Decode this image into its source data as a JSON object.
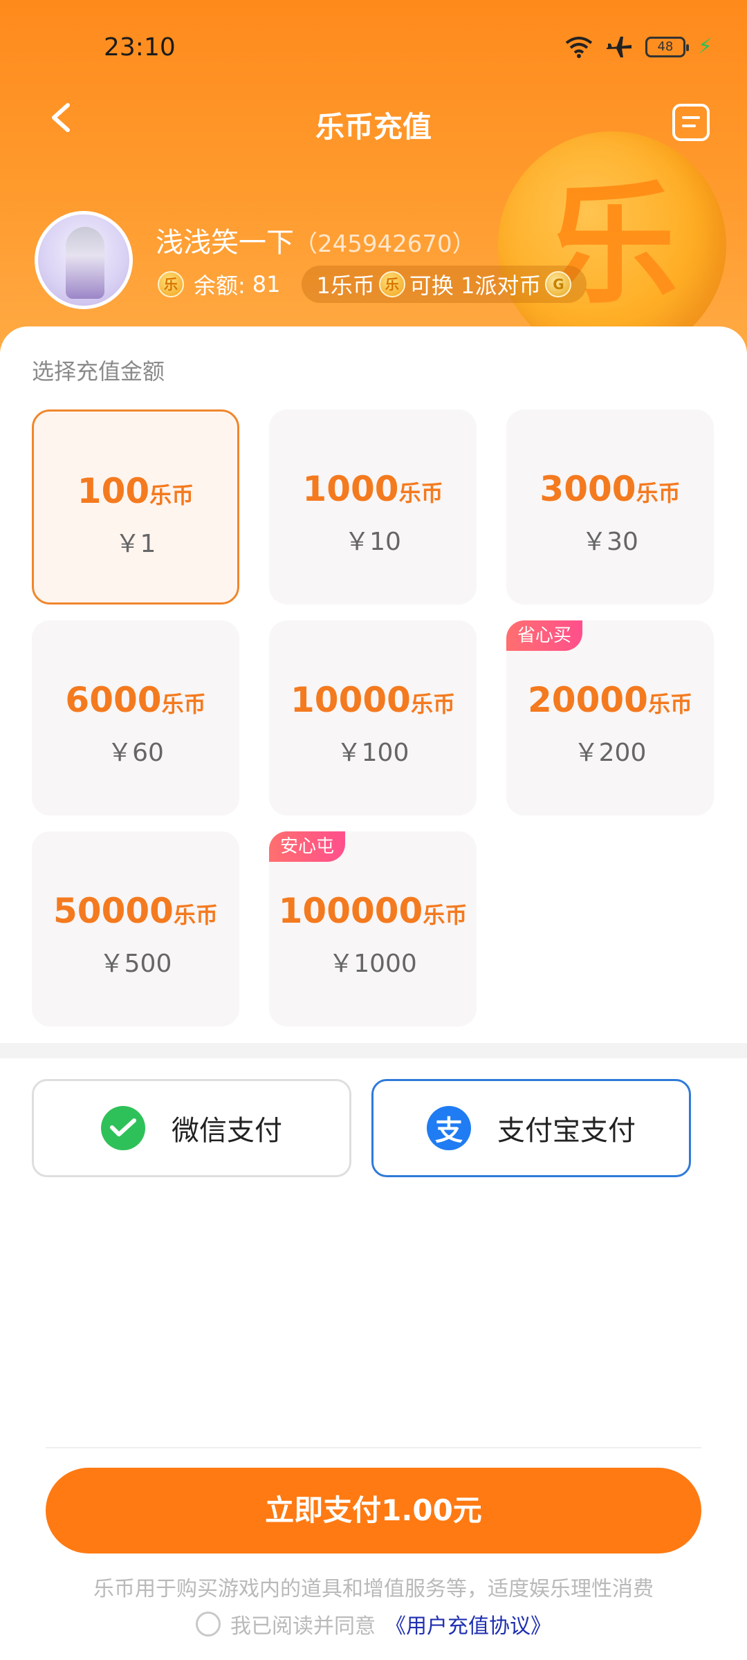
{
  "status_bar": {
    "time": "23:10",
    "battery": "48"
  },
  "nav": {
    "title": "乐币充值"
  },
  "decor": {
    "coin_char": "乐"
  },
  "user": {
    "name": "浅浅笑一下",
    "id": "（245942670）",
    "coin_icon_char": "乐",
    "balance_label": "余额:",
    "balance_value": "81",
    "exchange_prefix": "1乐币",
    "exchange_middle": "可换 1派对币",
    "pai_icon_char": "G"
  },
  "section_label": "选择充值金额",
  "packages": [
    {
      "amount": "100",
      "unit": "乐币",
      "price": "￥1",
      "selected": true
    },
    {
      "amount": "1000",
      "unit": "乐币",
      "price": "￥10"
    },
    {
      "amount": "3000",
      "unit": "乐币",
      "price": "￥30"
    },
    {
      "amount": "6000",
      "unit": "乐币",
      "price": "￥60"
    },
    {
      "amount": "10000",
      "unit": "乐币",
      "price": "￥100"
    },
    {
      "amount": "20000",
      "unit": "乐币",
      "price": "￥200",
      "tag": "省心买"
    },
    {
      "amount": "50000",
      "unit": "乐币",
      "price": "￥500"
    },
    {
      "amount": "100000",
      "unit": "乐币",
      "price": "￥1000",
      "tag": "安心屯"
    }
  ],
  "payment": {
    "wechat_label": "微信支付",
    "alipay_label": "支付宝支付",
    "alipay_icon_char": "支",
    "selected": "alipay"
  },
  "pay_now_label": "立即支付1.00元",
  "notice": "乐币用于购买游戏内的道具和增值服务等，适度娱乐理性消费",
  "agreement": {
    "text": "我已阅读并同意",
    "link": "《用户充值协议》"
  },
  "colors": {
    "accent": "#ff7a12",
    "selected_border": "#f0862c",
    "alipay_blue": "#2f7ad8",
    "wechat_green": "#2fc159"
  }
}
